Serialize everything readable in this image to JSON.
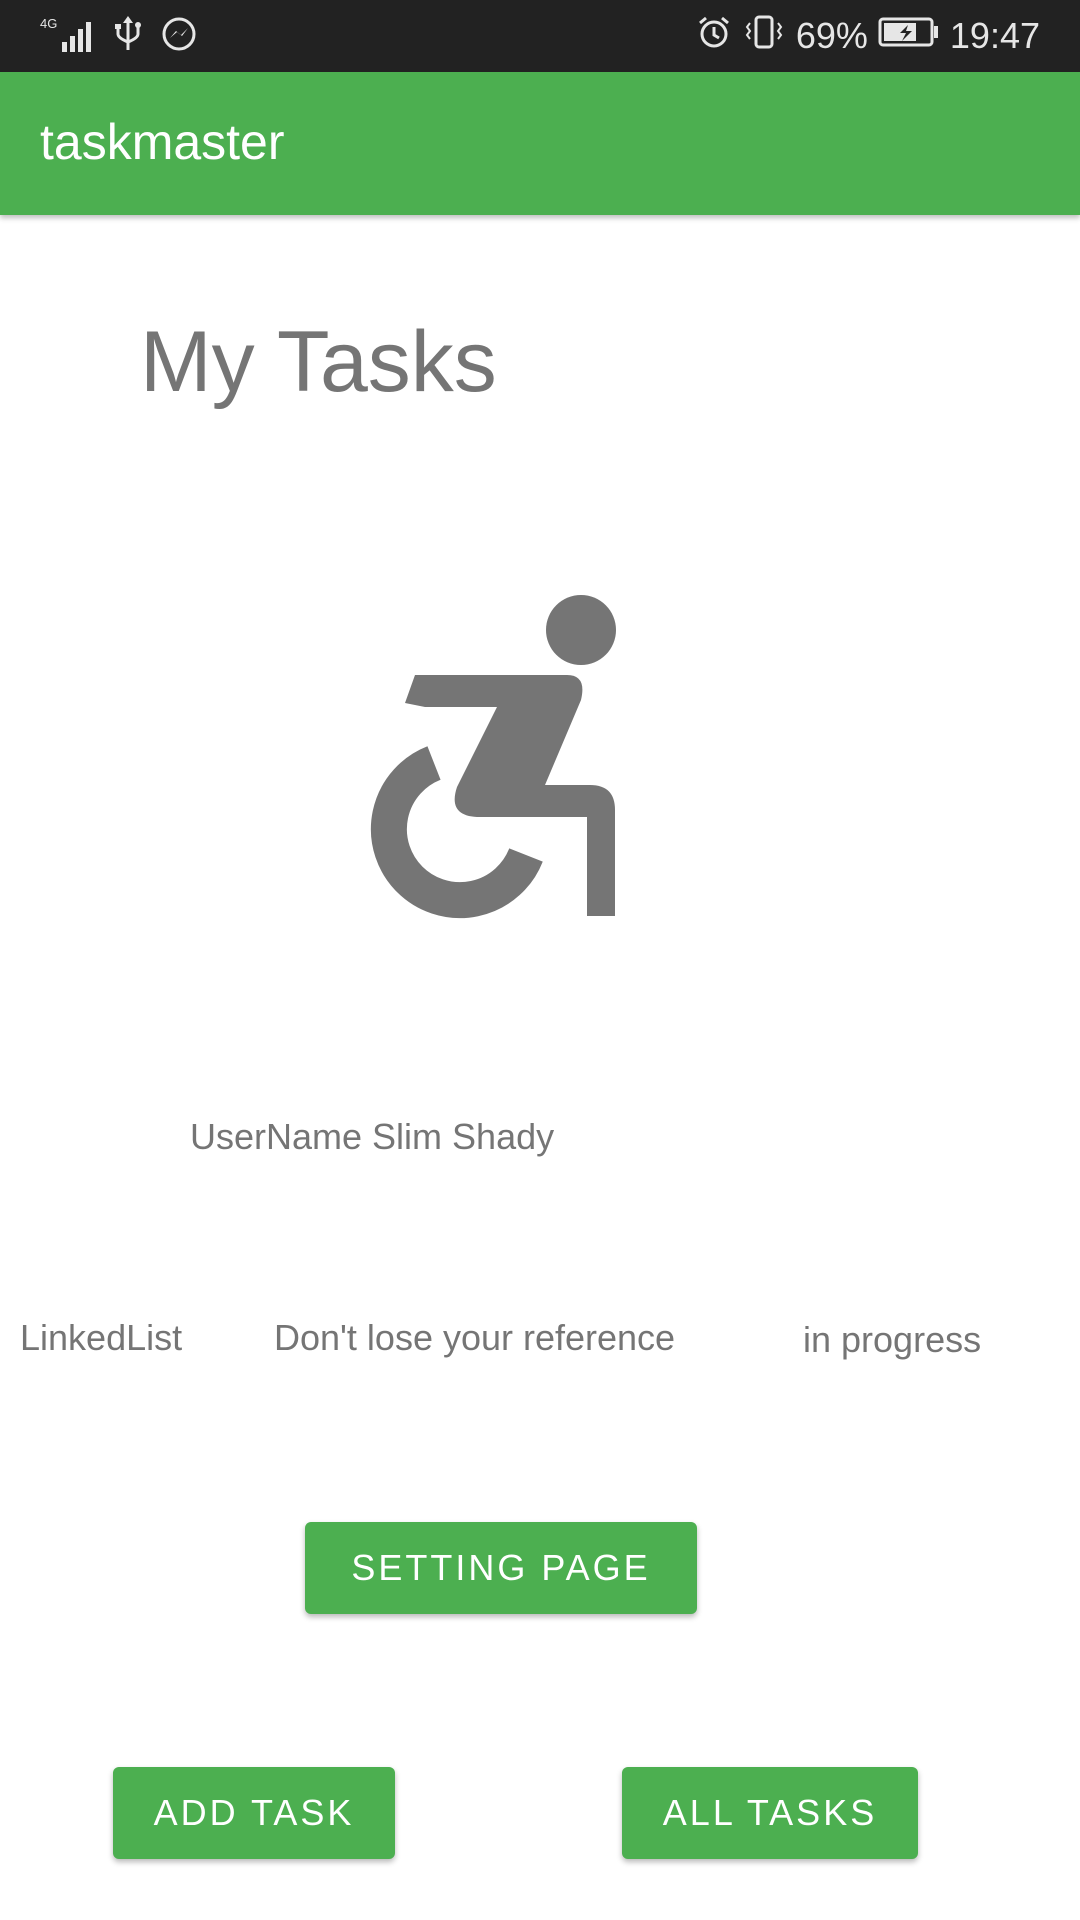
{
  "status_bar": {
    "network": "4G",
    "battery_percent": "69%",
    "time": "19:47"
  },
  "app_bar": {
    "title": "taskmaster"
  },
  "main": {
    "heading": "My Tasks",
    "hero_icon": "accessible-wheelchair-icon",
    "username_text": "UserName Slim Shady",
    "task": {
      "title": "LinkedList",
      "body": "Don't lose your reference",
      "state": "in progress"
    },
    "setting_button_label": "SETTING PAGE",
    "add_task_button_label": "ADD TASK",
    "all_tasks_button_label": "ALL TASKS"
  },
  "colors": {
    "primary": "#4caf50",
    "status_bar": "#222222",
    "text_gray": "#757575"
  }
}
